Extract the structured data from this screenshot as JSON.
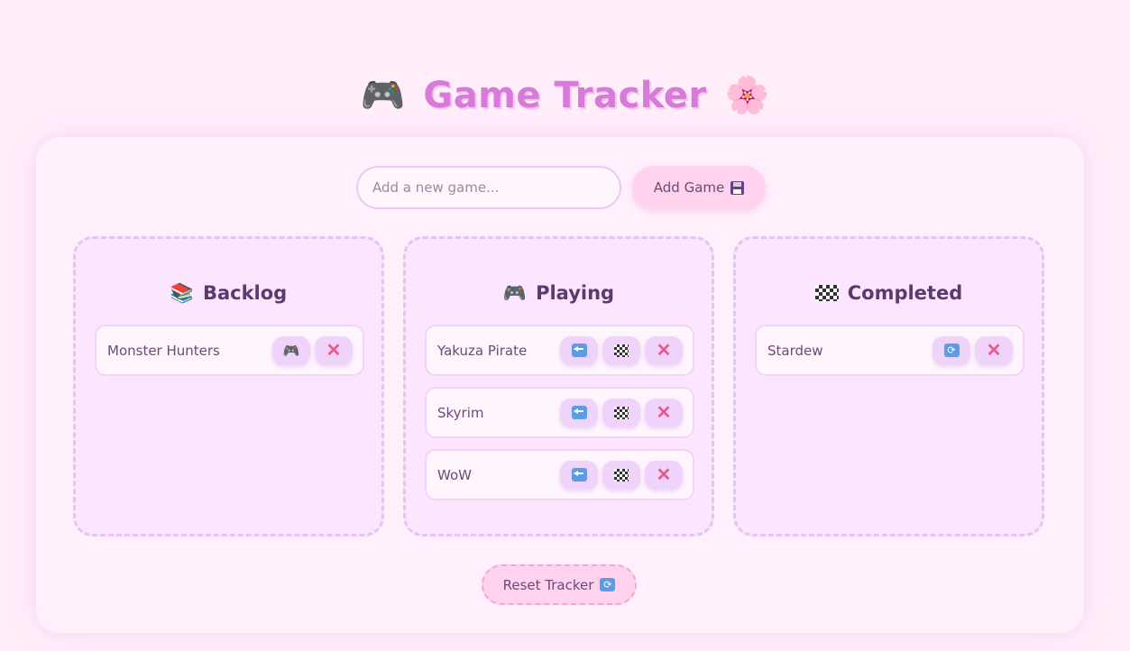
{
  "app": {
    "title": "Game Tracker",
    "title_left_emoji": "🎮",
    "title_right_emoji": "🌸"
  },
  "add": {
    "placeholder": "Add a new game...",
    "button_label": "Add Game",
    "button_icon": "floppy-disk-icon"
  },
  "columns": [
    {
      "title": "Backlog",
      "emoji": "📚",
      "games": [
        {
          "name": "Monster Hunters",
          "actions": [
            "play",
            "delete"
          ]
        }
      ]
    },
    {
      "title": "Playing",
      "emoji": "🎮",
      "games": [
        {
          "name": "Yakuza Pirate",
          "actions": [
            "back",
            "complete",
            "delete"
          ]
        },
        {
          "name": "Skyrim",
          "actions": [
            "back",
            "complete",
            "delete"
          ]
        },
        {
          "name": "WoW",
          "actions": [
            "back",
            "complete",
            "delete"
          ]
        }
      ]
    },
    {
      "title": "Completed",
      "emoji": "🏁",
      "games": [
        {
          "name": "Stardew",
          "actions": [
            "replay",
            "delete"
          ]
        }
      ]
    }
  ],
  "action_glyphs": {
    "play": "🎮",
    "delete": "✕"
  },
  "reset": {
    "label": "Reset Tracker",
    "icon": "refresh-icon"
  },
  "colors": {
    "background": "#ffeefa",
    "title": "#d77ad9",
    "column_bg": "#fbe5ff",
    "button_pink": "#ffd3ee",
    "action_button": "#efd3fb",
    "delete_x": "#e85a8c",
    "arrow_blue": "#5a9de6"
  }
}
